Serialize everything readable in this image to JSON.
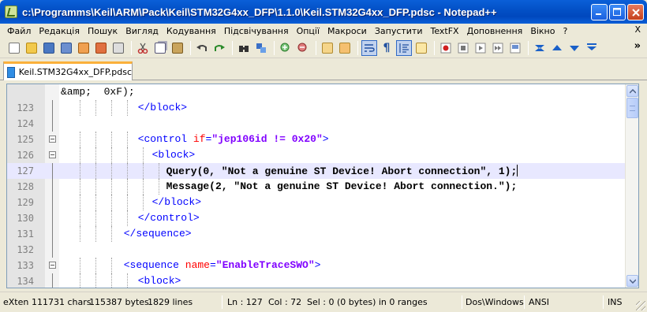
{
  "window": {
    "title": "c:\\Programms\\Keil\\ARM\\Pack\\Keil\\STM32G4xx_DFP\\1.1.0\\Keil.STM32G4xx_DFP.pdsc - Notepad++",
    "title_color": "#0054e3"
  },
  "menu": {
    "items": [
      "Файл",
      "Редакція",
      "Пошук",
      "Вигляд",
      "Кодування",
      "Підсвічування",
      "Опції",
      "Макроси",
      "Запустити",
      "TextFX",
      "Доповнення",
      "Вікно",
      "?"
    ],
    "close_label": "X"
  },
  "toolbar": {
    "icons": [
      "new-icon",
      "open-icon",
      "save-icon",
      "save-all-icon",
      "close-icon",
      "close-all-icon",
      "print-icon",
      "cut-icon",
      "copy-icon",
      "paste-icon",
      "undo-icon",
      "redo-icon",
      "find-icon",
      "replace-icon",
      "zoom-in-icon",
      "zoom-out-icon",
      "sync-v-icon",
      "sync-h-icon",
      "word-wrap-icon",
      "show-all-chars-icon",
      "indent-guide-icon",
      "doc-map-icon",
      "record-macro-icon",
      "stop-macro-icon",
      "playback-macro-icon",
      "run-macro-multiple-icon",
      "save-macro-icon",
      "fold-all-icon",
      "up-icon",
      "down-icon",
      "unfold-icon"
    ],
    "overflow": "»"
  },
  "tab": {
    "label": "Keil.STM32G4xx_DFP.pdsc"
  },
  "editor": {
    "top_fragment": "&amp;  0xF);",
    "lines": [
      {
        "num": "123",
        "segments": [
          {
            "t": "</block>",
            "c": "tag"
          }
        ]
      },
      {
        "num": "124",
        "segments": []
      },
      {
        "num": "125",
        "segments": [
          {
            "t": "<control ",
            "c": "tag"
          },
          {
            "t": "if",
            "c": "attr"
          },
          {
            "t": "=",
            "c": "tag"
          },
          {
            "t": "\"jep106id != 0x20\"",
            "c": "val"
          },
          {
            "t": ">",
            "c": "tag"
          }
        ]
      },
      {
        "num": "126",
        "segments": [
          {
            "t": "<block>",
            "c": "tag"
          }
        ]
      },
      {
        "num": "127",
        "segments": [
          {
            "t": "Query(0, \"Not a genuine ST Device! Abort connection\", 1);",
            "c": "txt"
          }
        ]
      },
      {
        "num": "128",
        "segments": [
          {
            "t": "Message(2, \"Not a genuine ST Device! Abort connection.\");",
            "c": "txt"
          }
        ]
      },
      {
        "num": "129",
        "segments": [
          {
            "t": "</block>",
            "c": "tag"
          }
        ]
      },
      {
        "num": "130",
        "segments": [
          {
            "t": "</control>",
            "c": "tag"
          }
        ]
      },
      {
        "num": "131",
        "segments": [
          {
            "t": "</sequence>",
            "c": "tag"
          }
        ]
      },
      {
        "num": "132",
        "segments": []
      },
      {
        "num": "133",
        "segments": [
          {
            "t": "<sequence ",
            "c": "tag"
          },
          {
            "t": "name",
            "c": "attr"
          },
          {
            "t": "=",
            "c": "tag"
          },
          {
            "t": "\"EnableTraceSWO\"",
            "c": "val"
          },
          {
            "t": ">",
            "c": "tag"
          }
        ]
      },
      {
        "num": "134",
        "segments": [
          {
            "t": "<block>",
            "c": "tag"
          }
        ]
      }
    ],
    "colors": {
      "tag": "#0000ff",
      "attr": "#ff0000",
      "value": "#8000ff",
      "current_line": "#e8e8ff"
    }
  },
  "status": {
    "type": "eXten",
    "chars": "111731 chars",
    "bytes": "115387 bytes",
    "lines": "1829 lines",
    "ln": "Ln : 127",
    "col": "Col : 72",
    "sel": "Sel : 0 (0 bytes) in 0 ranges",
    "eol": "Dos\\Windows",
    "encoding": "ANSI",
    "mode": "INS"
  }
}
